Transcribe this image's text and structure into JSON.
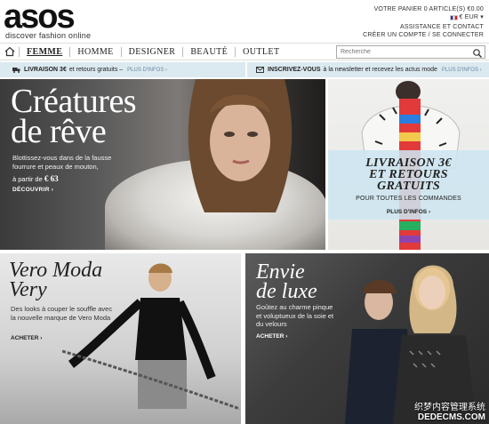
{
  "header": {
    "logo_word": "asos",
    "logo_tagline": "discover fashion online",
    "cart": "VOTRE PANIER 0 ARTICLE(S) €0.00",
    "currency": "€ EUR ▾",
    "help": "ASSISTANCE ET CONTACT",
    "account": "CRÉER UN COMPTE / SE CONNECTER"
  },
  "nav": {
    "items": [
      "FEMME",
      "HOMME",
      "DESIGNER",
      "BEAUTÉ",
      "OUTLET"
    ],
    "search_placeholder": "Recherche"
  },
  "promo": {
    "left_bold": "LIVRAISON 3€",
    "left_text": "et retours gratuits –",
    "left_more": "PLUS D'INFOS ›",
    "right_bold": "INSCRIVEZ-VOUS",
    "right_text": "à la newsletter et recevez les actus mode",
    "right_more": "PLUS D'INFOS ›"
  },
  "panels": {
    "creatures": {
      "title_line1": "Créatures",
      "title_line2": "de rêve",
      "body": "Blottissez-vous dans de la fausse fourrure et peaux de mouton,",
      "price_prefix": "à partir de",
      "price": "€ 63",
      "cta": "DÉCOUVRIR ›"
    },
    "livraison": {
      "title_line1": "LIVRAISON 3€",
      "title_line2": "ET RETOURS",
      "title_line3": "GRATUITS",
      "subtitle": "POUR TOUTES LES COMMANDES",
      "cta": "PLUS D'INFOS ›"
    },
    "vero_moda": {
      "title_line1": "Vero Moda",
      "title_line2": "Very",
      "body": "Des looks à couper le souffle avec la nouvelle marque de Vero Moda",
      "cta": "ACHETER ›"
    },
    "luxe": {
      "title_line1": "Envie",
      "title_line2": "de luxe",
      "body": "Goûtez au charme pinque et voluptueux de la soie et du velours",
      "cta": "ACHETER ›"
    }
  },
  "watermark": {
    "cn": "织梦内容管理系统",
    "url": "DEDECMS.COM"
  }
}
